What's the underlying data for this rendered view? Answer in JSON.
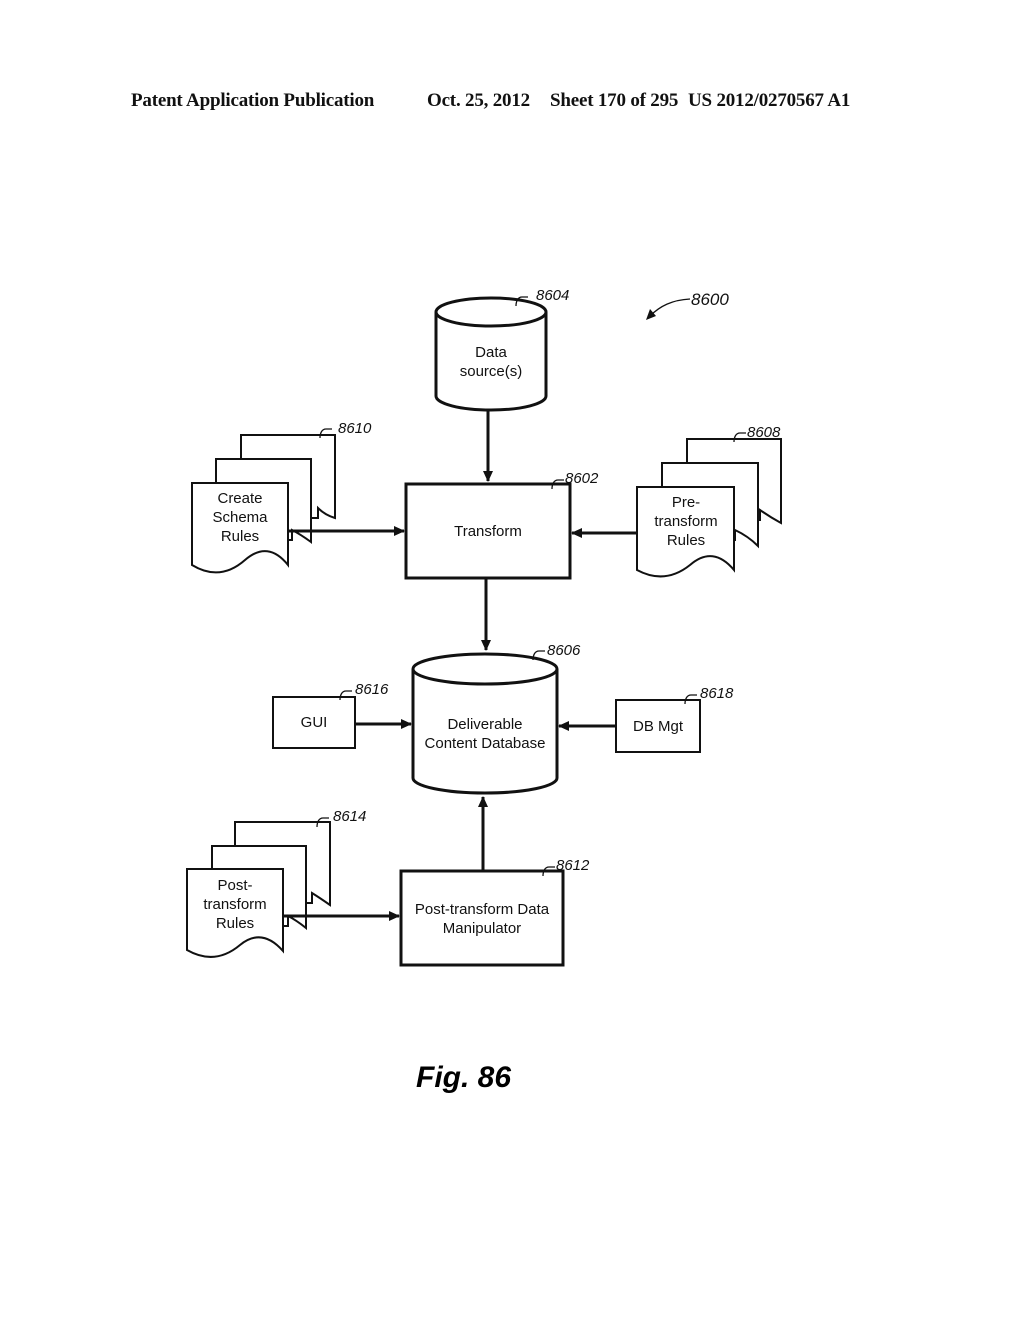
{
  "header": {
    "publication": "Patent Application Publication",
    "date": "Oct. 25, 2012",
    "sheet": "Sheet 170 of 295",
    "number": "US 2012/0270567 A1"
  },
  "diagram": {
    "figure_ref": "8600",
    "figure_label": "Fig. 86",
    "nodes": {
      "data_source": {
        "ref": "8604",
        "type": "database",
        "lines": [
          "Data",
          "source(s)"
        ]
      },
      "transform": {
        "ref": "8602",
        "type": "process",
        "lines": [
          "Transform"
        ]
      },
      "create_schema_rules": {
        "ref": "8610",
        "type": "document-stack",
        "lines": [
          "Create",
          "Schema",
          "Rules"
        ]
      },
      "pre_transform_rules": {
        "ref": "8608",
        "type": "document-stack",
        "lines": [
          "Pre-",
          "transform",
          "Rules"
        ]
      },
      "deliverable_db": {
        "ref": "8606",
        "type": "database",
        "lines": [
          "Deliverable",
          "Content Database"
        ]
      },
      "gui": {
        "ref": "8616",
        "type": "process",
        "lines": [
          "GUI"
        ]
      },
      "db_mgt": {
        "ref": "8618",
        "type": "process",
        "lines": [
          "DB Mgt"
        ]
      },
      "post_transform_rules": {
        "ref": "8614",
        "type": "document-stack",
        "lines": [
          "Post-",
          "transform",
          "Rules"
        ]
      },
      "post_transform_manipulator": {
        "ref": "8612",
        "type": "process",
        "lines": [
          "Post-transform Data",
          "Manipulator"
        ]
      }
    },
    "edges": [
      {
        "from": "data_source",
        "to": "transform"
      },
      {
        "from": "create_schema_rules",
        "to": "transform"
      },
      {
        "from": "pre_transform_rules",
        "to": "transform"
      },
      {
        "from": "transform",
        "to": "deliverable_db"
      },
      {
        "from": "gui",
        "to": "deliverable_db"
      },
      {
        "from": "db_mgt",
        "to": "deliverable_db"
      },
      {
        "from": "post_transform_rules",
        "to": "post_transform_manipulator"
      },
      {
        "from": "post_transform_manipulator",
        "to": "deliverable_db"
      }
    ]
  }
}
